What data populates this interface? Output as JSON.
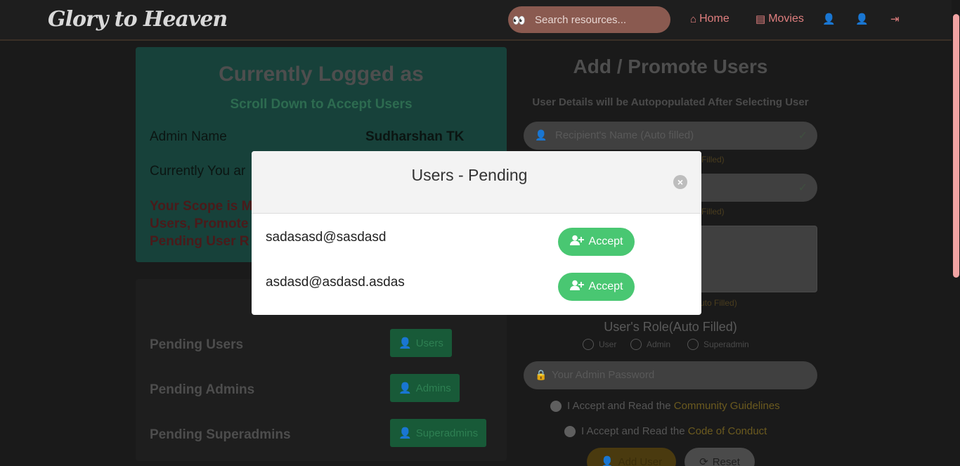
{
  "navbar": {
    "brand": "Glory to Heaven",
    "search_placeholder": "Search resources...",
    "links": [
      {
        "label": "Home",
        "icon": "home-icon"
      },
      {
        "label": "Movies",
        "icon": "file-icon"
      }
    ]
  },
  "left_card": {
    "title": "Currently Logged as",
    "subtitle": "Scroll Down to Accept Users",
    "admin_label": "Admin Name",
    "admin_value": "Sudharshan TK",
    "current_text": "Currently You ar",
    "scope_line1": "Your Scope is M",
    "scope_line2": "Users, Promote",
    "scope_line3": "Pending User R"
  },
  "pending": {
    "rows": [
      {
        "label": "Pending Users",
        "button": "Users"
      },
      {
        "label": "Pending Admins",
        "button": "Admins"
      },
      {
        "label": "Pending Superadmins",
        "button": "Superadmins"
      }
    ]
  },
  "form": {
    "title": "Add / Promote Users",
    "subtitle": "User Details will be Autopopulated After Selecting User",
    "recipient_placeholder": "Recipient's Name (Auto filled)",
    "hint1": "Filled)",
    "hint2": "Filled)",
    "hint3": "uto Filled)",
    "role_title": "User's Role(Auto Filled)",
    "roles": [
      "User",
      "Admin",
      "Superadmin"
    ],
    "password_placeholder": "Your Admin Password",
    "agree1_text": "I Accept and Read the ",
    "agree1_link": "Community Guidelines",
    "agree2_text": "I Accept and Read the ",
    "agree2_link": "Code of Conduct",
    "add_button": "Add User",
    "reset_button": "Reset"
  },
  "modal": {
    "title": "Users - Pending",
    "close": "×",
    "users": [
      {
        "email": "sadasasd@sasdasd",
        "action": "Accept"
      },
      {
        "email": "asdasd@asdasd.asdas",
        "action": "Accept"
      }
    ]
  },
  "colors": {
    "accept_green": "#49c772",
    "nav_link": "#e07f7f",
    "brand_card": "#17413a"
  }
}
